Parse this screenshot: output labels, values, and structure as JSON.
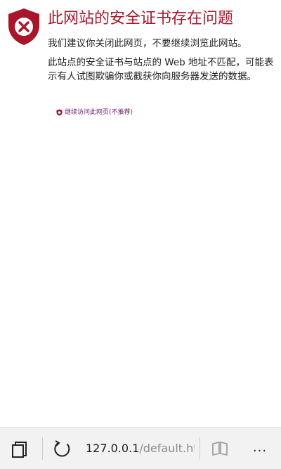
{
  "error_page": {
    "title": "此网站的安全证书存在问题",
    "recommendation": "我们建议你关闭此网页，不要继续浏览此网站。",
    "details": "此站点的安全证书与站点的 Web 地址不匹配，可能表示有人试图欺骗你或截获你向服务器发送的数据。",
    "continue_link": "继续访问此网页(不推荐)"
  },
  "address_bar": {
    "host": "127.0.0.1",
    "path": "/default.ht"
  },
  "toolbar": {
    "more_label": "..."
  },
  "colors": {
    "title_red": "#a8162c",
    "link_purple": "#6b1a6e",
    "toolbar_bg": "#f2f2f2"
  },
  "icons": {
    "shield": "shield-x-icon",
    "tabs": "tabs-icon",
    "refresh": "refresh-icon",
    "reading": "reading-view-icon"
  }
}
